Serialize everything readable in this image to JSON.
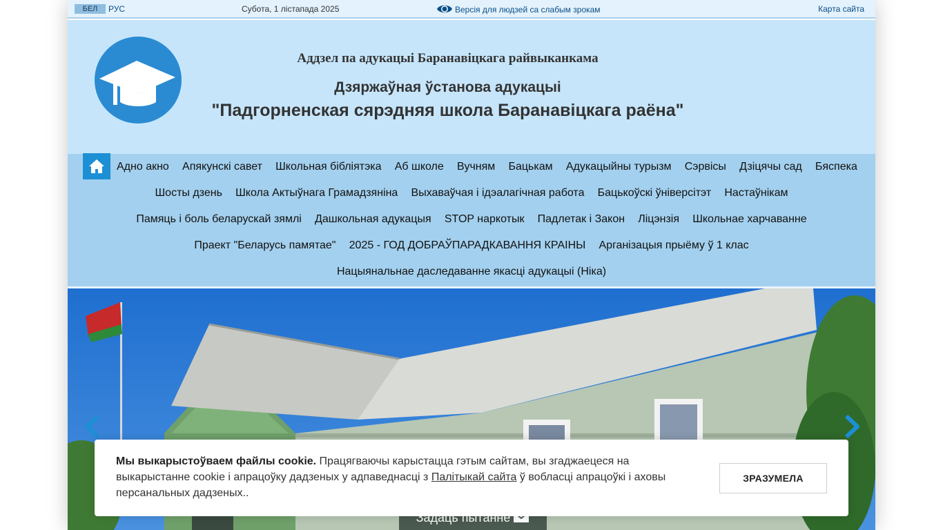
{
  "topbar": {
    "lang_bel": "БЕЛ",
    "lang_rus": "РУС",
    "date": "Субота, 1 лістапада 2025",
    "vision_link": "Версія для людзей са слабым зрокам",
    "sitemap": "Карта сайта"
  },
  "header": {
    "department": "Аддзел па адукацыі Баранавіцкага райвыканкама",
    "institution": "Дзяржаўная ўстанова адукацыі",
    "school_name": "\"Падгорненская сярэдняя школа Баранавіцкага раёна\""
  },
  "nav": {
    "home_icon": "home-icon",
    "rows": [
      [
        "Адно акно",
        "Апякунскі савет",
        "Школьная бібліятэка",
        "Аб школе",
        "Вучням",
        "Бацькам",
        "Адукацыйны турызм",
        "Сэрвісы",
        "Дзіцячы сад",
        "Бяспека"
      ],
      [
        "Шосты дзень",
        "Школа Актыўнага Грамадзяніна",
        "Выхаваўчая і ідэалагічная работа",
        "Бацькоўскі ўніверсітэт",
        "Настаўнікам"
      ],
      [
        "Памяць і боль беларускай зямлі",
        "Дашкольная адукацыя",
        "STOP наркотык",
        "Падлетак і Закон",
        "Ліцэнзія",
        "Школьнае харчаванне"
      ],
      [
        "Праект \"Беларусь памятае\"",
        "2025 - ГОД ДОБРАЎПАРАДКАВАННЯ КРАІНЫ",
        "Арганізацыя прыёму ў 1 клас"
      ],
      [
        "Нацыянальнае даследаванне якасці адукацыі (Ніка)"
      ]
    ]
  },
  "slider": {
    "prev_icon": "chevron-left-icon",
    "next_icon": "chevron-right-icon",
    "ask_button": "Задаць пытанне"
  },
  "cookie": {
    "title": "Мы выкарыстоўваем файлы cookie.",
    "text_before": " Працягваючы карыстацца гэтым сайтам, вы згаджаецеся на выкарыстанне cookie і апрацоўку дадзеных у адпаведнасці з ",
    "link": "Палітыкай сайта",
    "text_after": " ў вобласці апрацоўкі і аховы персанальных дадзеных..",
    "accept_button": "ЗРАЗУМЕЛА"
  },
  "colors": {
    "topbar_bg": "#e3f2fd",
    "header_bg": "#c6e5fb",
    "nav_bg": "#a3d0ee",
    "accent": "#1d8fd4"
  }
}
